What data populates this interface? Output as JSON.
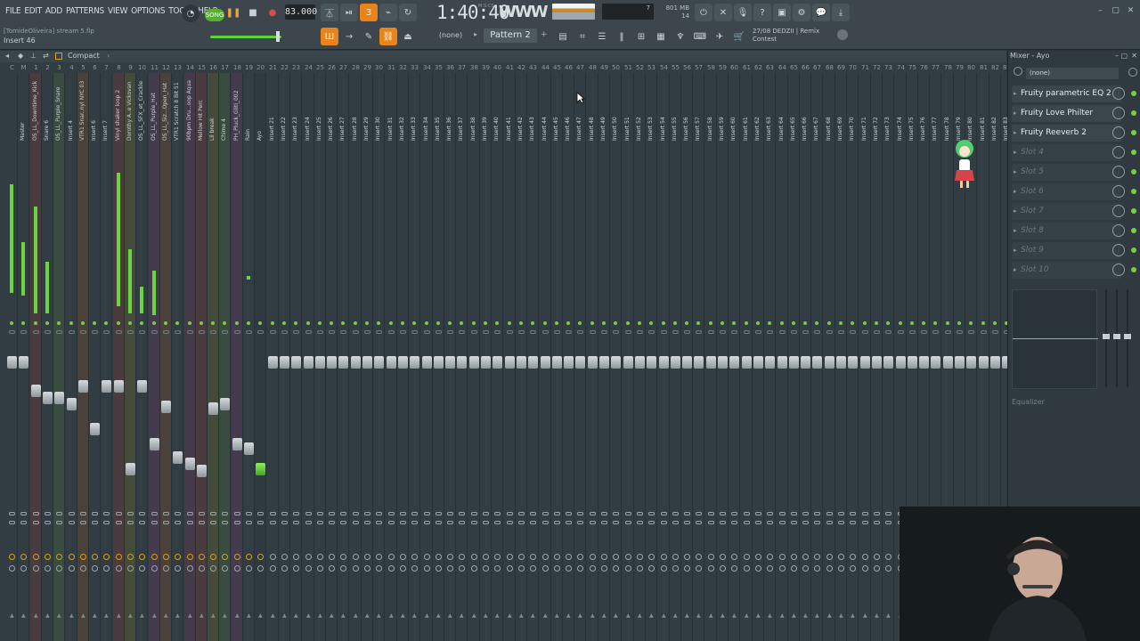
{
  "menu": [
    "FILE",
    "EDIT",
    "ADD",
    "PATTERNS",
    "VIEW",
    "OPTIONS",
    "TOOLS",
    "HELP"
  ],
  "toolbar": {
    "song_label": "SONG",
    "tempo": "83.000",
    "time": "1:40:40",
    "time_unit": "M:S:CS",
    "memory": "801 MB",
    "cpu": "7",
    "poly": "14",
    "pattern_none": "(none)",
    "pattern": "Pattern 2",
    "news_date": "27/08",
    "news_line1": "DEDZII | Remix",
    "news_line2": "Contest"
  },
  "file_info": {
    "user": "[TomideOliveira]",
    "project": "stream 5.flp",
    "hint": "Insert 46"
  },
  "mixer": {
    "view_label": "Compact",
    "tracks": [
      {
        "num": "C",
        "name": ""
      },
      {
        "num": "M",
        "name": "Master"
      },
      {
        "num": "1",
        "name": "OS_LL_Downtime_Kick"
      },
      {
        "num": "2",
        "name": "Snare 6"
      },
      {
        "num": "3",
        "name": "OS_LL_Purple_Snare"
      },
      {
        "num": "4",
        "name": "Insert 4"
      },
      {
        "num": "5",
        "name": "VTR1 Snar..nyl NYC 03"
      },
      {
        "num": "6",
        "name": "Insert 6"
      },
      {
        "num": "7",
        "name": "Insert 7"
      },
      {
        "num": "8",
        "name": "Vinyl shaker loop 2"
      },
      {
        "num": "9",
        "name": "Dorothy A..e Vickovan"
      },
      {
        "num": "10",
        "name": "OS_LL_SFX_et_Crackle"
      },
      {
        "num": "11",
        "name": "OS_LL_Purple_Hat"
      },
      {
        "num": "12",
        "name": "OS_LL_Siz...Open_Hat"
      },
      {
        "num": "13",
        "name": "VTR1 Scratch 8 Bit 51"
      },
      {
        "num": "14",
        "name": "90bpm Dru...oop Aqua"
      },
      {
        "num": "15",
        "name": "Mellow Hit Perc"
      },
      {
        "num": "16",
        "name": "Lil break"
      },
      {
        "num": "17",
        "name": "Chime 4"
      },
      {
        "num": "18",
        "name": "PH_Pluck_Gliti_002"
      },
      {
        "num": "19",
        "name": "Rain"
      },
      {
        "num": "20",
        "name": "Ayo"
      }
    ],
    "empty_insert_prefix": "Insert "
  },
  "right_panel": {
    "title": "Mixer - Ayo",
    "preset": "(none)",
    "slots": [
      {
        "label": "Fruity parametric EQ 2",
        "empty": false
      },
      {
        "label": "Fruity Love Philter",
        "empty": false
      },
      {
        "label": "Fruity Reeverb 2",
        "empty": false
      },
      {
        "label": "Slot 4",
        "empty": true
      },
      {
        "label": "Slot 5",
        "empty": true
      },
      {
        "label": "Slot 6",
        "empty": true
      },
      {
        "label": "Slot 7",
        "empty": true
      },
      {
        "label": "Slot 8",
        "empty": true
      },
      {
        "label": "Slot 9",
        "empty": true
      },
      {
        "label": "Slot 10",
        "empty": true
      }
    ],
    "eq_label": "Equalizer"
  },
  "colors": {
    "meter": "#6ad53c",
    "accent_orange": "#e8841a",
    "selected_track": "#57d23a",
    "track_tints": [
      "#5a7a3a",
      "#6b3a55",
      "#7a3a3a",
      "#6b6a2a",
      "#4a6a3a",
      "#6a3a6a",
      "#7a4a2a"
    ]
  }
}
